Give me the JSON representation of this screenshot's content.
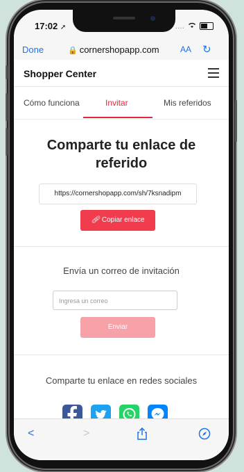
{
  "status": {
    "time": "17:02",
    "signal": "....",
    "location_arrow": "➚"
  },
  "browser": {
    "done_label": "Done",
    "url": "cornershopapp.com",
    "text_size_label": "AA",
    "icons": {
      "lock": "lock-icon",
      "reload": "reload-icon",
      "back": "back-icon",
      "forward": "forward-icon",
      "share": "share-icon",
      "compass": "compass-icon"
    }
  },
  "header": {
    "brand": "Shopper Center"
  },
  "tabs": [
    {
      "label": "Cómo funciona",
      "active": false
    },
    {
      "label": "Invitar",
      "active": true
    },
    {
      "label": "Mis referidos",
      "active": false
    }
  ],
  "main": {
    "heading_line1": "Comparte tu enlace de",
    "heading_line2": "referido",
    "referral_link": "https://cornershopapp.com/sh/7ksnadipm",
    "copy_button": "Copiar enlace",
    "email_section_title": "Envía un correo de invitación",
    "email_placeholder": "Ingresa un correo",
    "send_button": "Enviar",
    "social_section_title": "Comparte tu enlace en redes sociales",
    "social": [
      {
        "name": "facebook",
        "color": "#3b5998",
        "glyph": "f"
      },
      {
        "name": "twitter",
        "color": "#1da1f2",
        "glyph": "t"
      },
      {
        "name": "whatsapp",
        "color": "#25d366",
        "glyph": "w"
      },
      {
        "name": "messenger",
        "color": "#0084ff",
        "glyph": "m"
      }
    ]
  },
  "colors": {
    "accent": "#e3263b",
    "button": "#f13c4e",
    "button_disabled": "#f7a1a9",
    "link_blue": "#1a73e8"
  }
}
